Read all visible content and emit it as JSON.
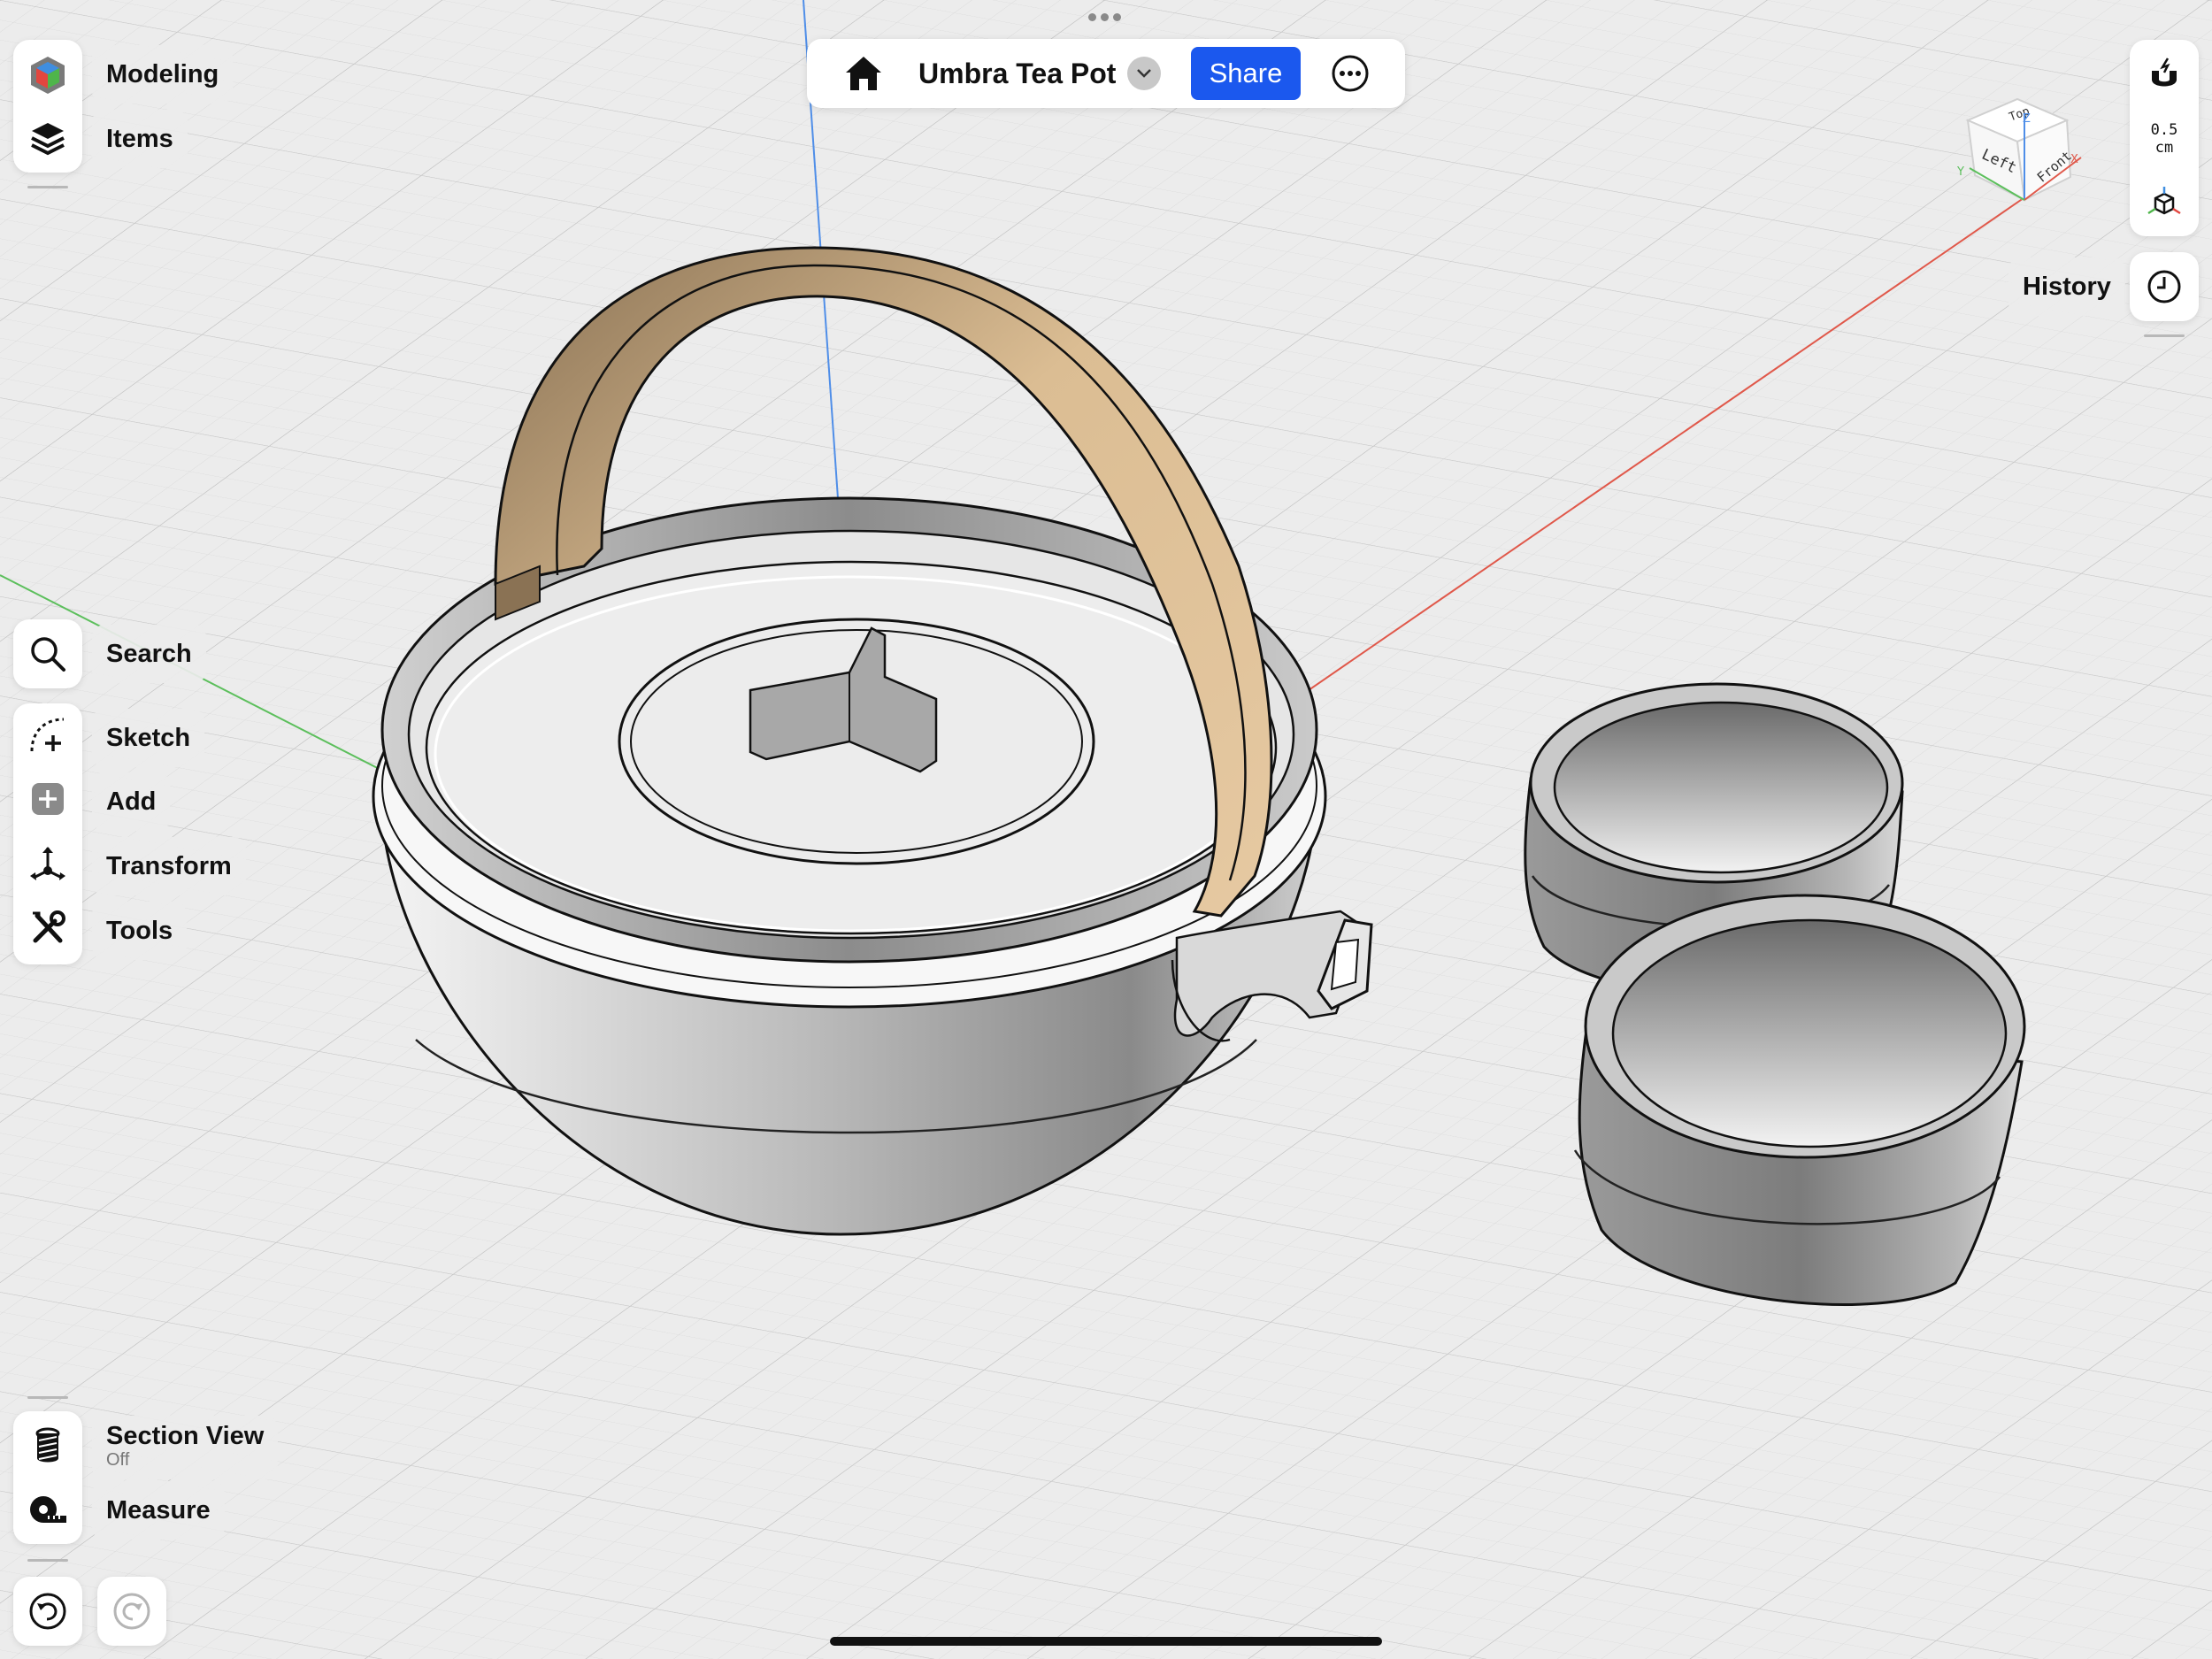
{
  "document": {
    "title": "Umbra Tea Pot"
  },
  "topbar": {
    "share_label": "Share"
  },
  "left_panel": {
    "modeling_label": "Modeling",
    "items_label": "Items",
    "search_label": "Search",
    "sketch_label": "Sketch",
    "add_label": "Add",
    "transform_label": "Transform",
    "tools_label": "Tools",
    "section_view_label": "Section View",
    "section_view_state": "Off",
    "measure_label": "Measure"
  },
  "right_panel": {
    "snap_value": "0.5",
    "snap_unit": "cm",
    "history_label": "History"
  },
  "view_cube": {
    "top": "Top",
    "left": "Left",
    "front": "Front",
    "axis_x": "X",
    "axis_y": "Y",
    "axis_z": "Z"
  },
  "colors": {
    "accent": "#1b58ee",
    "handle": "#dbbd93",
    "axis_x": "#e0584a",
    "axis_y": "#5cbf5c",
    "axis_z": "#4f8ee8"
  }
}
